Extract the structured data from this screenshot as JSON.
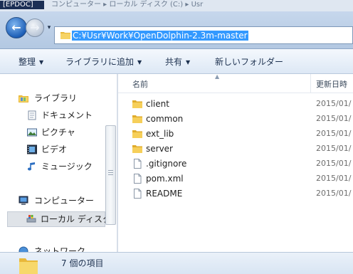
{
  "window_strip": {
    "left_tab": "[EPDOC]",
    "breadcrumb_text": "コンピューター ▸ ローカル ディスク (C:) ▸ Usr"
  },
  "address": {
    "path": "C:¥Usr¥Work¥OpenDolphin-2.3m-master"
  },
  "commandbar": {
    "organize": "整理",
    "add_to_library": "ライブラリに追加",
    "share": "共有",
    "new_folder": "新しいフォルダー"
  },
  "navpane": {
    "libraries": "ライブラリ",
    "documents": "ドキュメント",
    "pictures": "ピクチャ",
    "videos": "ビデオ",
    "music": "ミュージック",
    "computer": "コンピューター",
    "local_disk": "ローカル ディスク",
    "network": "ネットワーク"
  },
  "filelist": {
    "columns": {
      "name": "名前",
      "date": "更新日時"
    },
    "items": [
      {
        "name": "client",
        "type": "folder",
        "date": "2015/01/"
      },
      {
        "name": "common",
        "type": "folder",
        "date": "2015/01/"
      },
      {
        "name": "ext_lib",
        "type": "folder",
        "date": "2015/01/"
      },
      {
        "name": "server",
        "type": "folder",
        "date": "2015/01/"
      },
      {
        "name": ".gitignore",
        "type": "file",
        "date": "2015/01/"
      },
      {
        "name": "pom.xml",
        "type": "file",
        "date": "2015/01/"
      },
      {
        "name": "README",
        "type": "file",
        "date": "2015/01/"
      }
    ]
  },
  "status": {
    "item_count": "7 個の項目"
  },
  "colors": {
    "selection": "#3399ff",
    "folder": "#f2c94c",
    "chrome": "#c6d7ec"
  }
}
